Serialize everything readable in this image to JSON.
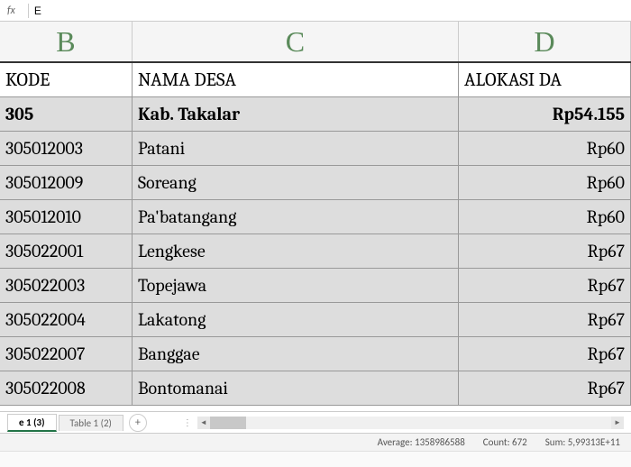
{
  "formula_bar": {
    "fx": "fx",
    "value": "E"
  },
  "columns": {
    "b": "B",
    "c": "C",
    "d": "D"
  },
  "header_row": {
    "kode": "KODE",
    "nama": "NAMA DESA",
    "alokasi": "ALOKASI DA"
  },
  "rows": [
    {
      "kode": "305",
      "nama": "Kab.  Takalar",
      "alokasi": "Rp54.155",
      "bold": true
    },
    {
      "kode": "305012003",
      "nama": "Patani",
      "alokasi": "Rp60"
    },
    {
      "kode": "305012009",
      "nama": "Soreang",
      "alokasi": "Rp60"
    },
    {
      "kode": "305012010",
      "nama": "Pa'batangang",
      "alokasi": "Rp60"
    },
    {
      "kode": "305022001",
      "nama": "Lengkese",
      "alokasi": "Rp67"
    },
    {
      "kode": "305022003",
      "nama": "Topejawa",
      "alokasi": "Rp67"
    },
    {
      "kode": "305022004",
      "nama": "Lakatong",
      "alokasi": "Rp67"
    },
    {
      "kode": "305022007",
      "nama": "Banggae",
      "alokasi": "Rp67"
    },
    {
      "kode": "305022008",
      "nama": "Bontomanai",
      "alokasi": "Rp67"
    }
  ],
  "tabs": {
    "active": "e 1 (3)",
    "inactive": "Table 1 (2)",
    "add": "+"
  },
  "status": {
    "average": "Average: 1358986588",
    "count": "Count: 672",
    "sum": "Sum: 5,99313E+11"
  }
}
